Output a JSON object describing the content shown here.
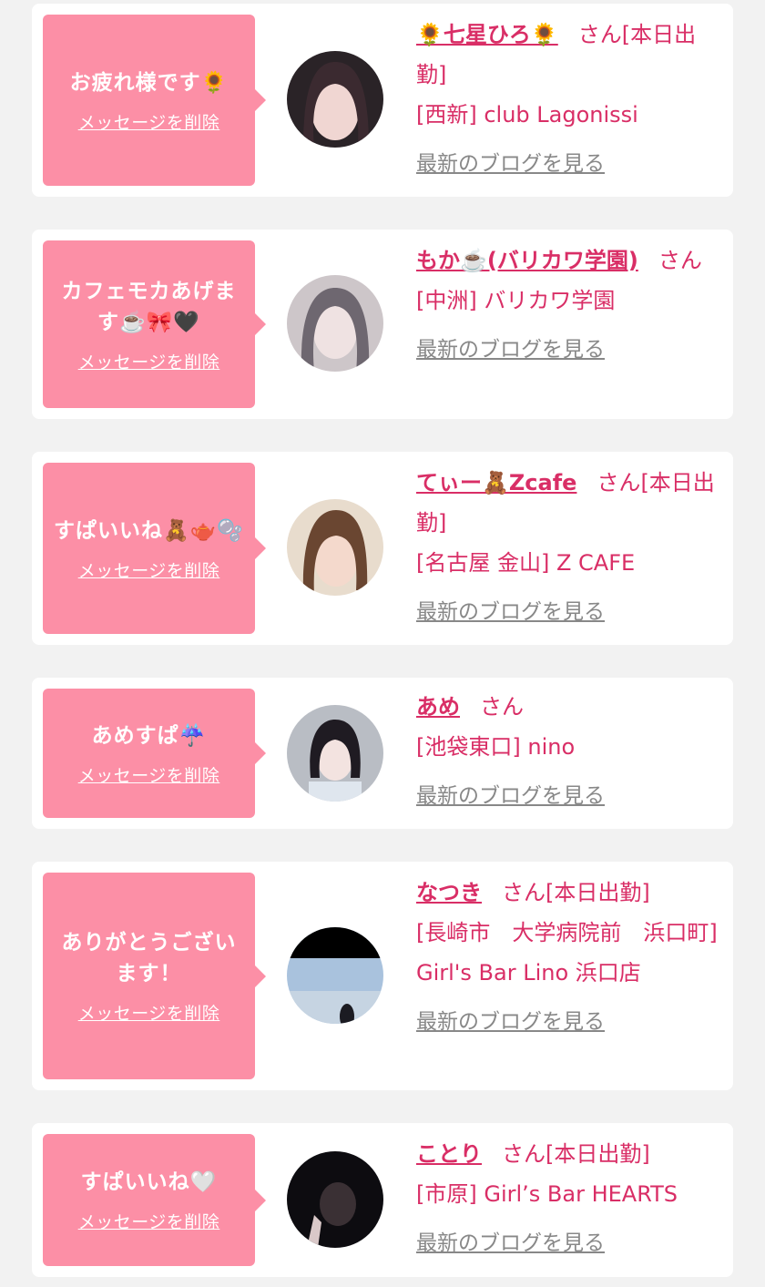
{
  "accent_color": "#d92e66",
  "bubble_color": "#fc8fa6",
  "items": [
    {
      "message": "お疲れ様です🌻",
      "delete_label": "メッセージを削除",
      "name": "🌻七星ひろ🌻",
      "honorific": "さん",
      "status": "[本日出勤]",
      "shop": "[西新] club Lagonissi",
      "blog_label": "最新のブログを見る"
    },
    {
      "message": "カフェモカあげます☕️🎀🖤",
      "delete_label": "メッセージを削除",
      "name": "もか☕️(バリカワ学園)",
      "honorific": "さん",
      "status": "",
      "shop": "[中洲] バリカワ学園",
      "blog_label": "最新のブログを見る"
    },
    {
      "message": "すぱいいね🧸🫖🫧",
      "delete_label": "メッセージを削除",
      "name": "てぃー🧸Zcafe",
      "honorific": "さん",
      "status": "[本日出勤]",
      "shop": "[名古屋 金山] Z CAFE",
      "blog_label": "最新のブログを見る"
    },
    {
      "message": "あめすぱ☔️",
      "delete_label": "メッセージを削除",
      "name": "あめ",
      "honorific": "さん",
      "status": "",
      "shop": "[池袋東口] nino",
      "blog_label": "最新のブログを見る"
    },
    {
      "message": "ありがとうございます！",
      "delete_label": "メッセージを削除",
      "name": "なつき",
      "honorific": "さん",
      "status": "[本日出勤]",
      "shop": "[長崎市　大学病院前　浜口町] Girl's Bar Lino 浜口店",
      "blog_label": "最新のブログを見る"
    },
    {
      "message": "すぱいいね🤍",
      "delete_label": "メッセージを削除",
      "name": "ことり",
      "honorific": "さん",
      "status": "[本日出勤]",
      "shop": "[市原] Girl’s Bar HEARTS",
      "blog_label": "最新のブログを見る"
    }
  ]
}
